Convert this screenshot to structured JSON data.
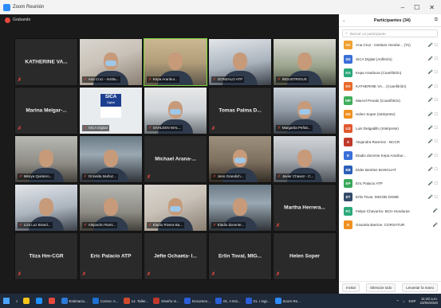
{
  "window": {
    "title": "Zoom Reunión",
    "min": "–",
    "max": "☐",
    "close": "✕",
    "recording_label": "Grabando"
  },
  "tiles": [
    {
      "name": "KATHERINE VA...",
      "caption": "",
      "video": false
    },
    {
      "name": "",
      "caption": "Ana Cruz - Institu...",
      "video": true,
      "style": "v1",
      "mask": true
    },
    {
      "name": "",
      "caption": "Kepa Aranbur...",
      "video": true,
      "style": "v2",
      "active": true
    },
    {
      "name": "",
      "caption": "GONZALO ATP",
      "video": true,
      "style": "v3"
    },
    {
      "name": "",
      "caption": "INDUSTRIOUS",
      "video": true,
      "style": "v4"
    },
    {
      "name": "Marina Melgar-...",
      "caption": "",
      "video": false
    },
    {
      "name": "",
      "caption": "SICA Digital",
      "video": true,
      "sica": true
    },
    {
      "name": "",
      "caption": "SAHLEEN WAL...",
      "video": true,
      "style": "v5",
      "mask": true
    },
    {
      "name": "Tomas Palma D...",
      "caption": "",
      "video": false
    },
    {
      "name": "",
      "caption": "Margarita Peñat...",
      "video": true,
      "style": "v6",
      "mask": true
    },
    {
      "name": "",
      "caption": "Mireya Quintero...",
      "video": true,
      "style": "v7"
    },
    {
      "name": "",
      "caption": "Gricelda Muñoz...",
      "video": true,
      "style": "v8"
    },
    {
      "name": "Michael Arana-...",
      "caption": "",
      "video": false
    },
    {
      "name": "",
      "caption": "Jens Grandich...",
      "video": true,
      "style": "v9",
      "mask": true
    },
    {
      "name": "",
      "caption": "Javier Chavez - C...",
      "video": true,
      "style": "v10"
    },
    {
      "name": "",
      "caption": "Liza Luz Brand...",
      "video": true,
      "style": "v3"
    },
    {
      "name": "",
      "caption": "Alejandro Rami...",
      "video": true,
      "style": "v7"
    },
    {
      "name": "",
      "caption": "Eladio Rivera Ba...",
      "video": true,
      "style": "v1",
      "mask": true
    },
    {
      "name": "",
      "caption": "Eladio docente...",
      "video": true,
      "style": "v8"
    },
    {
      "name": "Martha Herrera...",
      "caption": "",
      "video": false
    },
    {
      "name": "Tiiza Hm-CGR",
      "caption": "",
      "video": false
    },
    {
      "name": "Eric Palacio ATP",
      "caption": "",
      "video": false
    },
    {
      "name": "Jefte Ochaeta- I...",
      "caption": "",
      "video": false
    },
    {
      "name": "Erlin Toval, MIG...",
      "caption": "",
      "video": false
    },
    {
      "name": "Helen Soper",
      "caption": "",
      "video": false
    }
  ],
  "panel": {
    "title": "Participantes (34)",
    "search_placeholder": "Buscar un participante",
    "participants": [
      {
        "initials": "AC",
        "color": "#f0a030",
        "name": "Ana Cruz - Instituto Hondur... (Yo)",
        "icons": "🎤 ☐"
      },
      {
        "initials": "SD",
        "color": "#3a6fd8",
        "name": "SICA Digital (Anfitrión)",
        "icons": "🎤 ☐"
      },
      {
        "initials": "KA",
        "color": "#2aa87a",
        "name": "Kepa Aranbura (Coanfitrión)",
        "icons": "🎤 ☐"
      },
      {
        "initials": "KV",
        "color": "#e86a2a",
        "name": "KATHERINE VA... (Coanfitrión)",
        "icons": "🎤 ☐"
      },
      {
        "initials": "MP",
        "color": "#3fae5a",
        "name": "Marcel Penalo (Coanfitrión)",
        "icons": "🎤 ☐"
      },
      {
        "initials": "HS",
        "color": "#f09020",
        "name": "Helen Soper (Intérprete)",
        "icons": "🎤 ☐"
      },
      {
        "initials": "LD",
        "color": "#e05a30",
        "name": "Luis Delgadillo (Intérprete)",
        "icons": "🎤 ☐"
      },
      {
        "initials": "A",
        "color": "#c0392b",
        "name": "Alejandra Ramírez - BCCR",
        "icons": "🎤 ☐"
      },
      {
        "initials": "E",
        "color": "#3a6fd8",
        "name": "Eladio docente Kepa Aranbur...",
        "icons": "🎤 ☐"
      },
      {
        "initials": "EB",
        "color": "#2a5fb8",
        "name": "Elder Benítez BANGUAT",
        "icons": "🎤 ☐"
      },
      {
        "initials": "EP",
        "color": "#38a85a",
        "name": "Eric Palacio ATP",
        "icons": "🎤 ☐"
      },
      {
        "initials": "ET",
        "color": "#334a6a",
        "name": "Erlin Tovar, MIGOB DGME",
        "icons": "🎤 ☐"
      },
      {
        "initials": "FC",
        "color": "#2aa87a",
        "name": "Felipe Chavarría- BCH Honduras",
        "icons": "🎤"
      },
      {
        "initials": "G",
        "color": "#f09020",
        "name": "Graciela Barrios- CORSATUR",
        "icons": "🎤"
      }
    ],
    "footer": {
      "invite": "Invitar",
      "mute_all": "Silenciar todo",
      "raise": "Levantar la mano"
    }
  },
  "taskbar": {
    "items": [
      {
        "label": "",
        "color": "#f5c518"
      },
      {
        "label": "",
        "color": "#1e90ff"
      },
      {
        "label": "",
        "color": "#e8473c"
      },
      {
        "label": "Estimacio...",
        "color": "#2b7bd8"
      },
      {
        "label": "Correo: A...",
        "color": "#1e6fd0"
      },
      {
        "label": "14. Taller...",
        "color": "#d04a2a"
      },
      {
        "label": "Diseño m...",
        "color": "#c0392b"
      },
      {
        "label": "Documen...",
        "color": "#2b5fd8"
      },
      {
        "label": "01. A Est...",
        "color": "#2b5fd8"
      },
      {
        "label": "01. I ingr...",
        "color": "#2b5fd8"
      },
      {
        "label": "Zoom Re...",
        "color": "#2d8cff"
      }
    ],
    "time": "11:20 a.m.",
    "date": "23/06/2020",
    "lang": "ESP"
  }
}
